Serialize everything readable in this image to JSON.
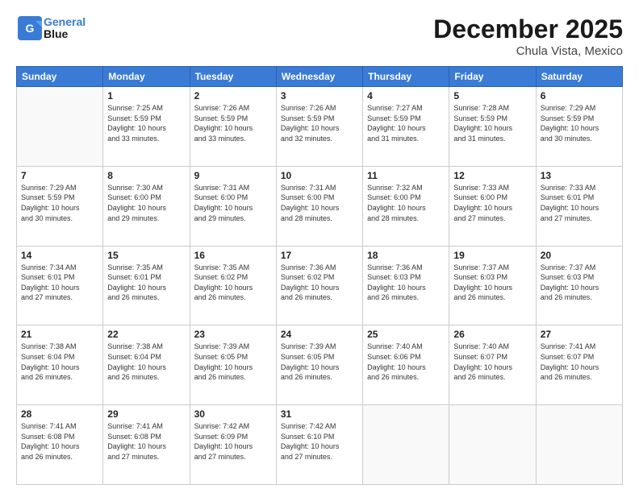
{
  "header": {
    "logo_line1": "General",
    "logo_line2": "Blue",
    "month": "December 2025",
    "location": "Chula Vista, Mexico"
  },
  "weekdays": [
    "Sunday",
    "Monday",
    "Tuesday",
    "Wednesday",
    "Thursday",
    "Friday",
    "Saturday"
  ],
  "weeks": [
    [
      {
        "day": "",
        "info": ""
      },
      {
        "day": "1",
        "info": "Sunrise: 7:25 AM\nSunset: 5:59 PM\nDaylight: 10 hours\nand 33 minutes."
      },
      {
        "day": "2",
        "info": "Sunrise: 7:26 AM\nSunset: 5:59 PM\nDaylight: 10 hours\nand 33 minutes."
      },
      {
        "day": "3",
        "info": "Sunrise: 7:26 AM\nSunset: 5:59 PM\nDaylight: 10 hours\nand 32 minutes."
      },
      {
        "day": "4",
        "info": "Sunrise: 7:27 AM\nSunset: 5:59 PM\nDaylight: 10 hours\nand 31 minutes."
      },
      {
        "day": "5",
        "info": "Sunrise: 7:28 AM\nSunset: 5:59 PM\nDaylight: 10 hours\nand 31 minutes."
      },
      {
        "day": "6",
        "info": "Sunrise: 7:29 AM\nSunset: 5:59 PM\nDaylight: 10 hours\nand 30 minutes."
      }
    ],
    [
      {
        "day": "7",
        "info": "Sunrise: 7:29 AM\nSunset: 5:59 PM\nDaylight: 10 hours\nand 30 minutes."
      },
      {
        "day": "8",
        "info": "Sunrise: 7:30 AM\nSunset: 6:00 PM\nDaylight: 10 hours\nand 29 minutes."
      },
      {
        "day": "9",
        "info": "Sunrise: 7:31 AM\nSunset: 6:00 PM\nDaylight: 10 hours\nand 29 minutes."
      },
      {
        "day": "10",
        "info": "Sunrise: 7:31 AM\nSunset: 6:00 PM\nDaylight: 10 hours\nand 28 minutes."
      },
      {
        "day": "11",
        "info": "Sunrise: 7:32 AM\nSunset: 6:00 PM\nDaylight: 10 hours\nand 28 minutes."
      },
      {
        "day": "12",
        "info": "Sunrise: 7:33 AM\nSunset: 6:00 PM\nDaylight: 10 hours\nand 27 minutes."
      },
      {
        "day": "13",
        "info": "Sunrise: 7:33 AM\nSunset: 6:01 PM\nDaylight: 10 hours\nand 27 minutes."
      }
    ],
    [
      {
        "day": "14",
        "info": "Sunrise: 7:34 AM\nSunset: 6:01 PM\nDaylight: 10 hours\nand 27 minutes."
      },
      {
        "day": "15",
        "info": "Sunrise: 7:35 AM\nSunset: 6:01 PM\nDaylight: 10 hours\nand 26 minutes."
      },
      {
        "day": "16",
        "info": "Sunrise: 7:35 AM\nSunset: 6:02 PM\nDaylight: 10 hours\nand 26 minutes."
      },
      {
        "day": "17",
        "info": "Sunrise: 7:36 AM\nSunset: 6:02 PM\nDaylight: 10 hours\nand 26 minutes."
      },
      {
        "day": "18",
        "info": "Sunrise: 7:36 AM\nSunset: 6:03 PM\nDaylight: 10 hours\nand 26 minutes."
      },
      {
        "day": "19",
        "info": "Sunrise: 7:37 AM\nSunset: 6:03 PM\nDaylight: 10 hours\nand 26 minutes."
      },
      {
        "day": "20",
        "info": "Sunrise: 7:37 AM\nSunset: 6:03 PM\nDaylight: 10 hours\nand 26 minutes."
      }
    ],
    [
      {
        "day": "21",
        "info": "Sunrise: 7:38 AM\nSunset: 6:04 PM\nDaylight: 10 hours\nand 26 minutes."
      },
      {
        "day": "22",
        "info": "Sunrise: 7:38 AM\nSunset: 6:04 PM\nDaylight: 10 hours\nand 26 minutes."
      },
      {
        "day": "23",
        "info": "Sunrise: 7:39 AM\nSunset: 6:05 PM\nDaylight: 10 hours\nand 26 minutes."
      },
      {
        "day": "24",
        "info": "Sunrise: 7:39 AM\nSunset: 6:05 PM\nDaylight: 10 hours\nand 26 minutes."
      },
      {
        "day": "25",
        "info": "Sunrise: 7:40 AM\nSunset: 6:06 PM\nDaylight: 10 hours\nand 26 minutes."
      },
      {
        "day": "26",
        "info": "Sunrise: 7:40 AM\nSunset: 6:07 PM\nDaylight: 10 hours\nand 26 minutes."
      },
      {
        "day": "27",
        "info": "Sunrise: 7:41 AM\nSunset: 6:07 PM\nDaylight: 10 hours\nand 26 minutes."
      }
    ],
    [
      {
        "day": "28",
        "info": "Sunrise: 7:41 AM\nSunset: 6:08 PM\nDaylight: 10 hours\nand 26 minutes."
      },
      {
        "day": "29",
        "info": "Sunrise: 7:41 AM\nSunset: 6:08 PM\nDaylight: 10 hours\nand 27 minutes."
      },
      {
        "day": "30",
        "info": "Sunrise: 7:42 AM\nSunset: 6:09 PM\nDaylight: 10 hours\nand 27 minutes."
      },
      {
        "day": "31",
        "info": "Sunrise: 7:42 AM\nSunset: 6:10 PM\nDaylight: 10 hours\nand 27 minutes."
      },
      {
        "day": "",
        "info": ""
      },
      {
        "day": "",
        "info": ""
      },
      {
        "day": "",
        "info": ""
      }
    ]
  ]
}
